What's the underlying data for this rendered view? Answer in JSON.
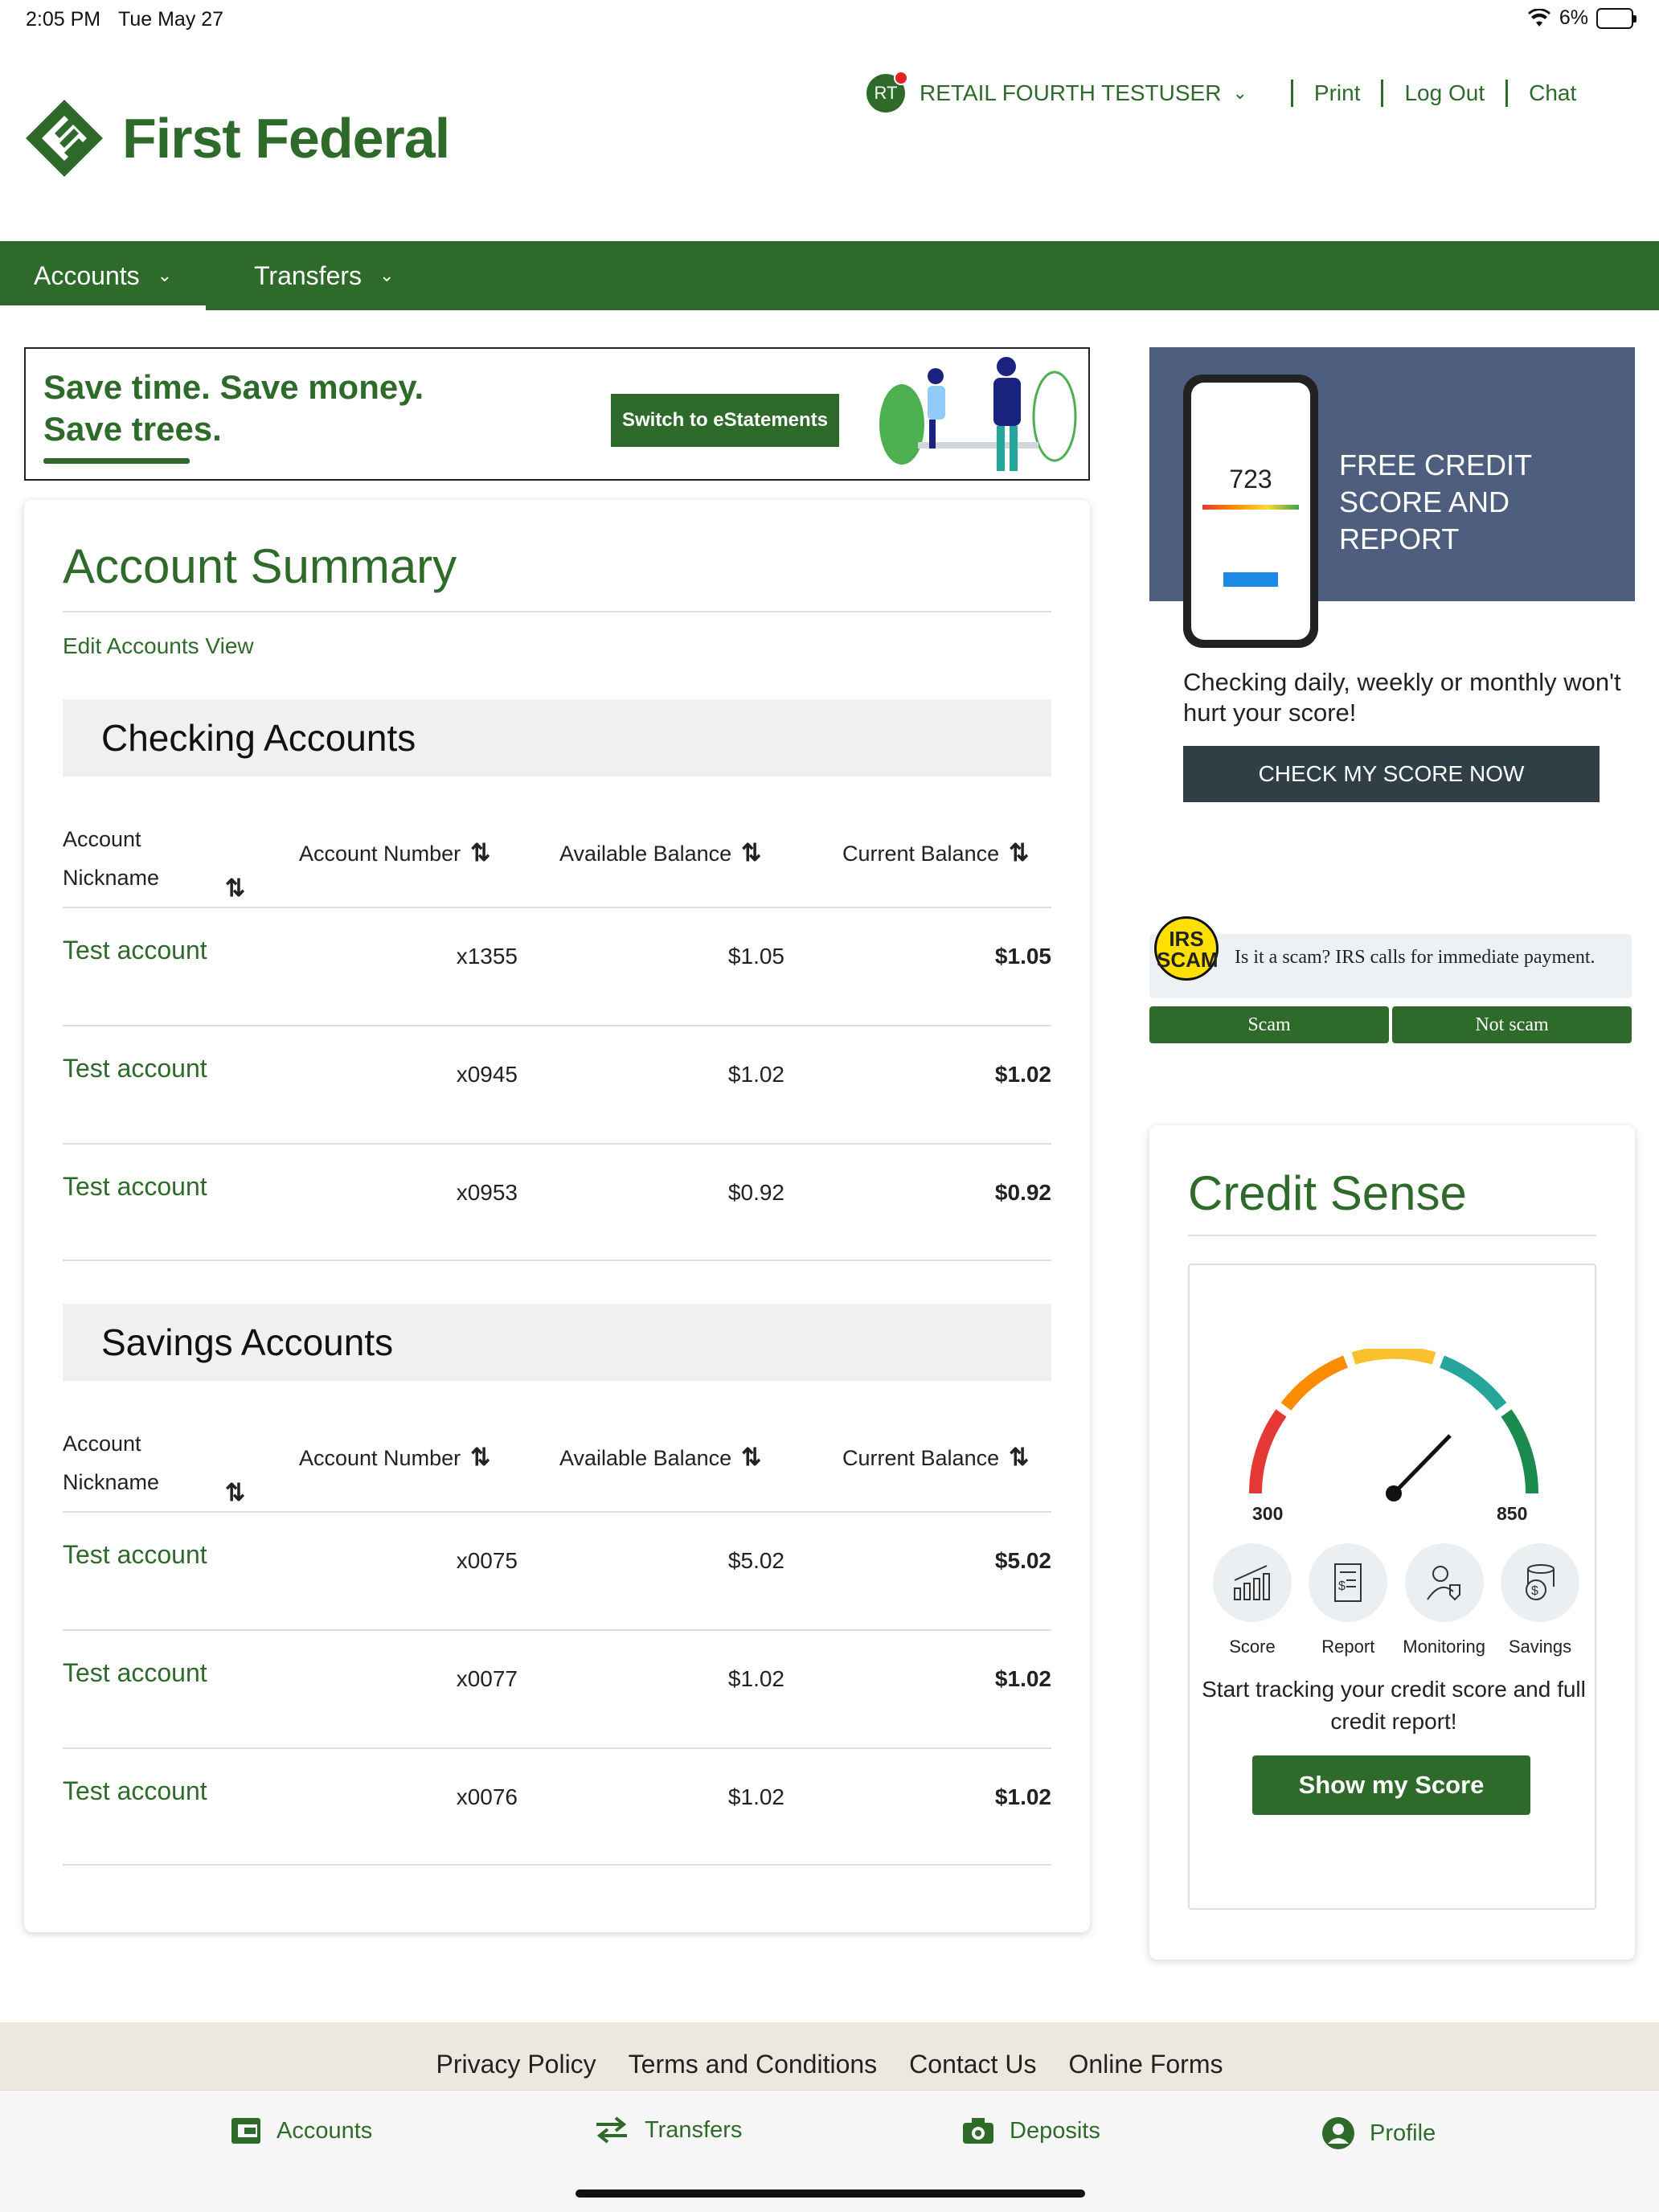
{
  "status_bar": {
    "time": "2:05 PM",
    "date": "Tue May 27",
    "battery": "6%"
  },
  "brand": {
    "name": "First Federal",
    "color": "#2e6b2a"
  },
  "header": {
    "avatar_initials": "RT",
    "user_name": "RETAIL FOURTH TESTUSER",
    "print": "Print",
    "logout": "Log Out",
    "chat": "Chat"
  },
  "nav": {
    "accounts": "Accounts",
    "transfers": "Transfers"
  },
  "banner": {
    "line1": "Save time. Save money.",
    "line2": "Save trees.",
    "button": "Switch to eStatements"
  },
  "summary": {
    "title": "Account Summary",
    "edit_link": "Edit Accounts View",
    "columns": {
      "nick1": "Account",
      "nick2": "Nickname",
      "number": "Account Number",
      "available": "Available Balance",
      "current": "Current Balance"
    },
    "checking": {
      "title": "Checking Accounts",
      "rows": [
        {
          "nickname": "Test account",
          "number": "x1355",
          "available": "$1.05",
          "current": "$1.05"
        },
        {
          "nickname": "Test account",
          "number": "x0945",
          "available": "$1.02",
          "current": "$1.02"
        },
        {
          "nickname": "Test account",
          "number": "x0953",
          "available": "$0.92",
          "current": "$0.92"
        }
      ]
    },
    "savings": {
      "title": "Savings Accounts",
      "rows": [
        {
          "nickname": "Test account",
          "number": "x0075",
          "available": "$5.02",
          "current": "$5.02"
        },
        {
          "nickname": "Test account",
          "number": "x0077",
          "available": "$1.02",
          "current": "$1.02"
        },
        {
          "nickname": "Test account",
          "number": "x0076",
          "available": "$1.02",
          "current": "$1.02"
        }
      ]
    }
  },
  "promo": {
    "headline": "FREE CREDIT SCORE AND REPORT",
    "phone_score": "723",
    "subtext": "Checking daily, weekly or monthly won't hurt your score!",
    "button": "CHECK MY SCORE NOW"
  },
  "poll": {
    "badge_line1": "IRS",
    "badge_line2": "SCAM",
    "question": "Is it a scam? IRS calls for immediate payment.",
    "option1": "Scam",
    "option2": "Not scam"
  },
  "credit_sense": {
    "title": "Credit Sense",
    "min": "300",
    "max": "850",
    "icons": [
      "Score",
      "Report",
      "Monitoring",
      "Savings"
    ],
    "message": "Start tracking your credit score and full credit report!",
    "button": "Show my Score"
  },
  "footer": {
    "links": [
      "Privacy Policy",
      "Terms and Conditions",
      "Contact Us",
      "Online Forms"
    ]
  },
  "tabbar": {
    "accounts": "Accounts",
    "transfers": "Transfers",
    "deposits": "Deposits",
    "profile": "Profile"
  }
}
